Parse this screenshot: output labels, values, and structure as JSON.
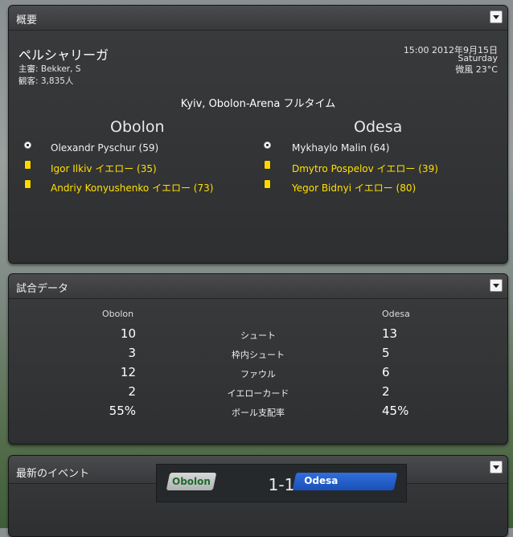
{
  "overview": {
    "title": "概要",
    "league": "ペルシャリーガ",
    "referee": "主審: Bekker, S",
    "attendance": "観客: 3,835人",
    "datetime": "15:00 2012年9月15日",
    "weekday": "Saturday",
    "weather": "微風 23°C",
    "venue": "Kyiv, Obolon-Arena フルタイム",
    "home_team": "Obolon",
    "away_team": "Odesa",
    "home_events": [
      {
        "icon": "goal-ball-icon",
        "text": "Olexandr Pyschur (59)"
      },
      {
        "icon": "yellow-card-icon",
        "text": "Igor Ilkiv イエロー (35)"
      },
      {
        "icon": "yellow-card-icon",
        "text": "Andriy Konyushenko イエロー (73)"
      }
    ],
    "away_events": [
      {
        "icon": "goal-ball-icon",
        "text": "Mykhaylo Malin (64)"
      },
      {
        "icon": "yellow-card-icon",
        "text": "Dmytro Pospelov イエロー (39)"
      },
      {
        "icon": "yellow-card-icon",
        "text": "Yegor Bidnyi イエロー (80)"
      }
    ]
  },
  "match_stats": {
    "title": "試合データ",
    "home": "Obolon",
    "away": "Odesa",
    "rows": [
      {
        "label": "シュート",
        "home": "10",
        "away": "13"
      },
      {
        "label": "枠内シュート",
        "home": "3",
        "away": "5"
      },
      {
        "label": "ファウル",
        "home": "12",
        "away": "6"
      },
      {
        "label": "イエローカード",
        "home": "2",
        "away": "2"
      },
      {
        "label": "ボール支配率",
        "home": "55%",
        "away": "45%"
      }
    ]
  },
  "latest_events": {
    "title": "最新のイベント",
    "home": "Obolon",
    "score": "1-1",
    "away": "Odesa"
  },
  "colors": {
    "card_yellow": "#ffd800",
    "away_badge": "#2f6fdc",
    "home_badge_text": "#1e6a2c"
  }
}
